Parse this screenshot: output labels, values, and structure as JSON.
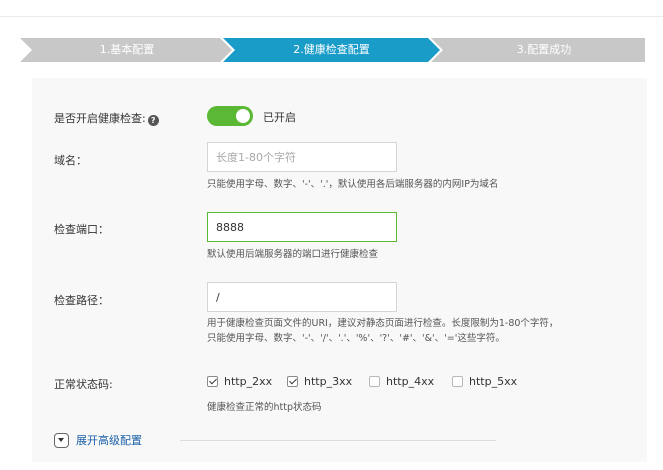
{
  "steps": [
    {
      "label": "1.基本配置",
      "state": "done"
    },
    {
      "label": "2.健康检查配置",
      "state": "active"
    },
    {
      "label": "3.配置成功",
      "state": "pending"
    }
  ],
  "colors": {
    "step_inactive": "#c8c8c8",
    "step_active": "#1a9cc9",
    "toggle_on": "#5bb834",
    "link": "#1a5fa8"
  },
  "health_check": {
    "label": "是否开启健康检查:",
    "help_icon": "question-circle-icon",
    "enabled": true,
    "status_text": "已开启"
  },
  "domain": {
    "label": "域名：",
    "value": "",
    "placeholder": "长度1-80个字符",
    "hint": "只能使用字母、数字、'-'、'.'，默认使用各后端服务器的内网IP为域名"
  },
  "port": {
    "label": "检查端口：",
    "value": "8888",
    "hint": "默认使用后端服务器的端口进行健康检查"
  },
  "path": {
    "label": "检查路径：",
    "value": "/",
    "hint_line1": "用于健康检查页面文件的URI，建议对静态页面进行检查。长度限制为1-80个字符，",
    "hint_line2": "只能使用字母、数字、'-'、'/'、'.'、'%'、'?'、'#'、'&'、'='这些字符。"
  },
  "status_codes": {
    "label": "正常状态码:",
    "options": [
      {
        "label": "http_2xx",
        "checked": true
      },
      {
        "label": "http_3xx",
        "checked": true
      },
      {
        "label": "http_4xx",
        "checked": false
      },
      {
        "label": "http_5xx",
        "checked": false
      }
    ],
    "hint": "健康检查正常的http状态码"
  },
  "advanced": {
    "label": "展开高级配置",
    "icon": "chevron-down-icon"
  }
}
